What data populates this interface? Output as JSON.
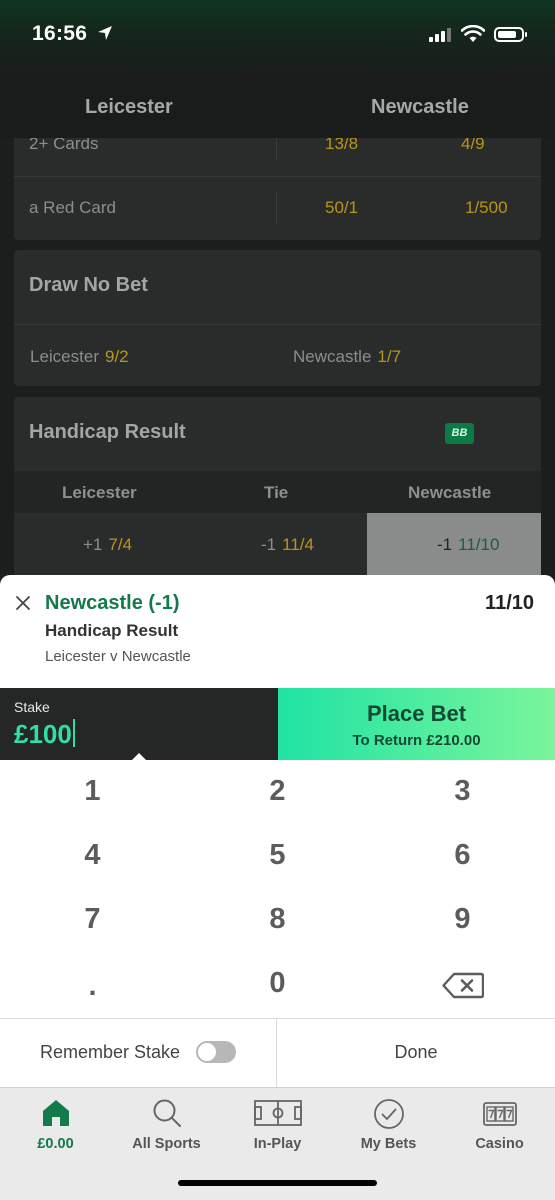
{
  "status_bar": {
    "time": "16:56"
  },
  "match_header": {
    "home": "Leicester",
    "away": "Newcastle"
  },
  "cards_market": {
    "rows": [
      {
        "label": "2+ Cards",
        "odds_home": "13/8",
        "odds_away": "4/9"
      },
      {
        "label": "a Red Card",
        "odds_home": "50/1",
        "odds_away": "1/500"
      }
    ]
  },
  "draw_no_bet": {
    "title": "Draw No Bet",
    "home_label": "Leicester",
    "home_odds": "9/2",
    "away_label": "Newcastle",
    "away_odds": "1/7"
  },
  "handicap_result": {
    "title": "Handicap Result",
    "badge": "BB",
    "headers": [
      "Leicester",
      "Tie",
      "Newcastle"
    ],
    "cells": [
      {
        "line": "+1",
        "odds": "7/4"
      },
      {
        "line": "-1",
        "odds": "11/4"
      },
      {
        "line": "-1",
        "odds": "11/10"
      }
    ]
  },
  "bet_slip": {
    "selection": "Newcastle (-1)",
    "price": "11/10",
    "market": "Handicap Result",
    "event": "Leicester v Newcastle"
  },
  "stake": {
    "label": "Stake",
    "value": "£100"
  },
  "place_bet": {
    "label": "Place Bet",
    "return_text": "To Return £210.00"
  },
  "keypad": {
    "keys": [
      "1",
      "2",
      "3",
      "4",
      "5",
      "6",
      "7",
      "8",
      "9",
      ".",
      "0"
    ]
  },
  "remember_stake": {
    "label": "Remember Stake",
    "enabled": false
  },
  "done_label": "Done",
  "tab_bar": {
    "tabs": [
      {
        "label": "£0.00",
        "icon": "home-icon",
        "active": true
      },
      {
        "label": "All Sports",
        "icon": "search-icon",
        "active": false
      },
      {
        "label": "In-Play",
        "icon": "pitch-icon",
        "active": false
      },
      {
        "label": "My Bets",
        "icon": "check-circle-icon",
        "active": false
      },
      {
        "label": "Casino",
        "icon": "slot-machine-icon",
        "active": false
      }
    ]
  },
  "colors": {
    "brand_green": "#127a4b",
    "odds_yellow": "#b8951c",
    "stake_green": "#2fe0a2",
    "place_bet_gradient": [
      "#20e3a4",
      "#7af59b"
    ]
  }
}
